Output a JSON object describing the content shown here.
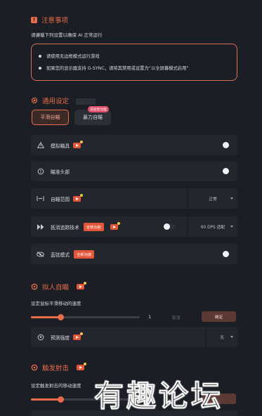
{
  "notice": {
    "title": "注意事项",
    "subtitle": "请遵循下列设置以确保 AI 正常运行",
    "items": [
      "请使用无边框模式运行游戏",
      "如果您的显示器支持 G-SYNC，请将其禁用或设置为“以全屏幕模式启用”"
    ]
  },
  "general": {
    "title": "通用设定",
    "modes": [
      "平滑自瞄",
      "暴力自瞄"
    ],
    "mode_badge": "试验性功能",
    "rows": [
      {
        "label": "模拟瞄具",
        "toggle": true
      },
      {
        "label": "瞄准头部",
        "toggle": true
      },
      {
        "label": "自瞄范围",
        "select": "正常"
      },
      {
        "label": "抵消追踪技术",
        "badge": "全新功能",
        "toggle": true,
        "select": "60 DPS 适配"
      },
      {
        "label": "蓝弦模式",
        "badge": "全新功能",
        "toggle": true
      }
    ]
  },
  "humanize": {
    "title": "拟人自瞄",
    "slider_label": "设定鼠标平滑移动的速度",
    "slider_value": "1",
    "slider_fraction": 0.27,
    "cancel": "取消",
    "confirm": "确定",
    "predict_label": "预测强度",
    "predict_value": "无"
  },
  "trigger": {
    "title": "触发射击",
    "slider_label": "设定触发射击的移动速度",
    "slider_fraction": 0.27
  },
  "watermark": "有趣论坛",
  "colors": {
    "accent": "#e86b4a",
    "background": "#1b1e24",
    "row": "#23262d"
  }
}
